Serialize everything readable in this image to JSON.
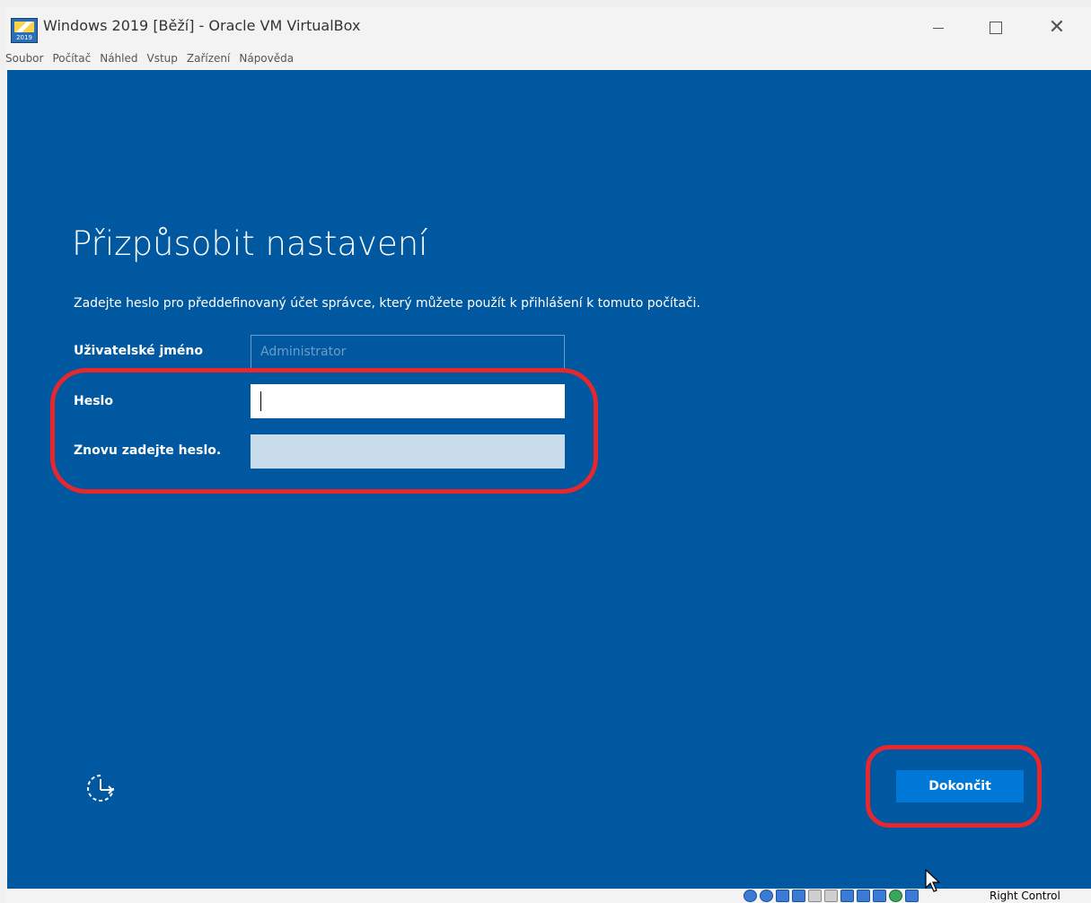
{
  "window": {
    "title": "Windows 2019 [Běží] - Oracle VM VirtualBox",
    "icon_year": "2019"
  },
  "menu": [
    "Soubor",
    "Počítač",
    "Náhled",
    "Vstup",
    "Zařízení",
    "Nápověda"
  ],
  "setup": {
    "title": "Přizpůsobit nastavení",
    "instructions": "Zadejte heslo pro předdefinovaný účet správce, který můžete použít k přihlášení k tomuto počítači.",
    "username_label": "Uživatelské jméno",
    "username_placeholder": "Administrator",
    "password_label": "Heslo",
    "password_value": "",
    "repeat_label": "Znovu zadejte heslo.",
    "repeat_value": "",
    "finish_button": "Dokončit"
  },
  "statusbar": {
    "host_key": "Right Control"
  },
  "colors": {
    "setup_background": "#0059a0",
    "accent_button": "#0078d7",
    "highlight_annotation": "#e8262d"
  },
  "icons": {
    "accessibility": "ease-of-access-icon",
    "app": "virtualbox-vm-icon"
  }
}
